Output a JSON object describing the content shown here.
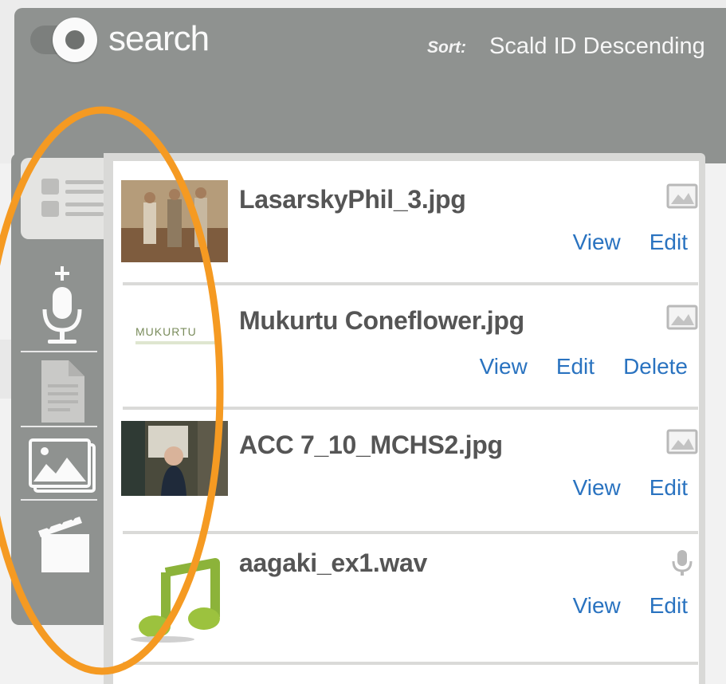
{
  "header": {
    "search_label": "search",
    "sort_label": "Sort:",
    "sort_value": "Scald ID Descending"
  },
  "sidebar": {
    "items": [
      {
        "name": "list-view",
        "icon": "list-icon",
        "active": true
      },
      {
        "name": "add-audio",
        "icon": "microphone-plus-icon",
        "active": false
      },
      {
        "name": "document",
        "icon": "document-icon",
        "active": false
      },
      {
        "name": "image",
        "icon": "image-stack-icon",
        "active": false
      },
      {
        "name": "video",
        "icon": "clapperboard-icon",
        "active": false
      }
    ]
  },
  "items": [
    {
      "name": "LasarskyPhil_3.jpg",
      "type": "image",
      "actions": [
        "View",
        "Edit"
      ]
    },
    {
      "name": "Mukurtu Coneflower.jpg",
      "type": "image",
      "actions": [
        "View",
        "Edit",
        "Delete"
      ],
      "thumb_text": "MUKURTU"
    },
    {
      "name": "ACC 7_10_MCHS2.jpg",
      "type": "image",
      "actions": [
        "View",
        "Edit"
      ]
    },
    {
      "name": "aagaki_ex1.wav",
      "type": "audio",
      "actions": [
        "View",
        "Edit"
      ]
    }
  ],
  "colors": {
    "header_bg": "#8f9290",
    "link": "#2a73c0",
    "highlight": "#f59a22",
    "title_text": "#555555"
  }
}
